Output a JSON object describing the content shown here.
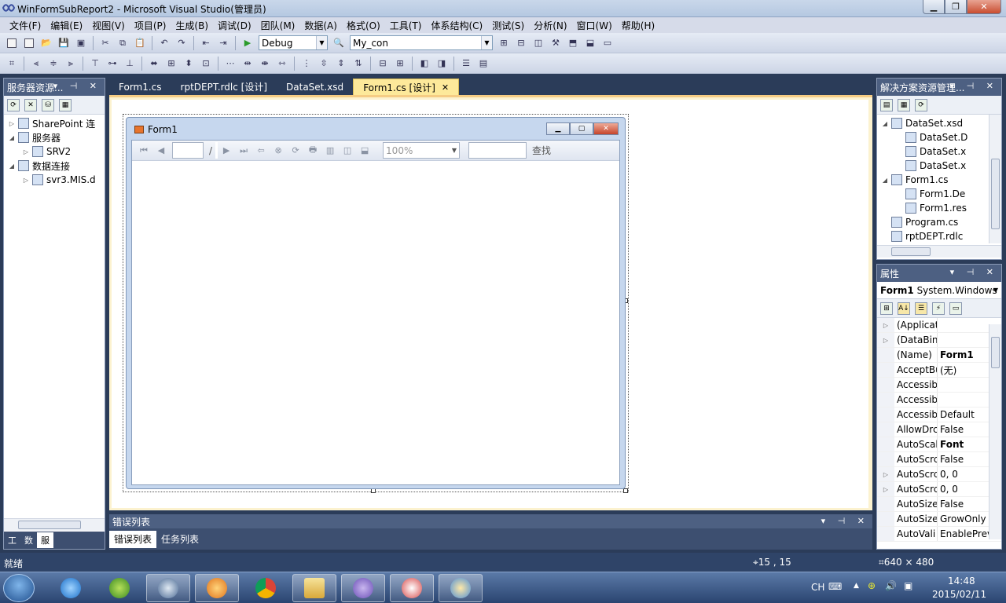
{
  "window": {
    "title": "WinFormSubReport2 - Microsoft Visual Studio(管理员)"
  },
  "menu": [
    "文件(F)",
    "编辑(E)",
    "视图(V)",
    "项目(P)",
    "生成(B)",
    "调试(D)",
    "团队(M)",
    "数据(A)",
    "格式(O)",
    "工具(T)",
    "体系结构(C)",
    "测试(S)",
    "分析(N)",
    "窗口(W)",
    "帮助(H)"
  ],
  "toolbar": {
    "config": "Debug",
    "connection": "My_con"
  },
  "server_explorer": {
    "title": "服务器资源...",
    "nodes": [
      {
        "label": "SharePoint 连",
        "indent": 0,
        "expander": "▷"
      },
      {
        "label": "服务器",
        "indent": 0,
        "expander": "◢"
      },
      {
        "label": "SRV2",
        "indent": 1,
        "expander": "▷"
      },
      {
        "label": "数据连接",
        "indent": 0,
        "expander": "◢"
      },
      {
        "label": "svr3.MIS.d",
        "indent": 1,
        "expander": "▷"
      }
    ],
    "bottom_tabs": [
      "工",
      "数",
      "服"
    ]
  },
  "doc_tabs": [
    {
      "label": "Form1.cs",
      "active": false
    },
    {
      "label": "rptDEPT.rdlc [设计]",
      "active": false
    },
    {
      "label": "DataSet.xsd",
      "active": false
    },
    {
      "label": "Form1.cs [设计]",
      "active": true
    }
  ],
  "form": {
    "title": "Form1",
    "viewer": {
      "page_sep": "/",
      "zoom": "100%",
      "find_label": "查找"
    }
  },
  "solution_explorer": {
    "title": "解决方案资源管理...",
    "nodes": [
      {
        "label": "DataSet.xsd",
        "indent": 0,
        "expander": "◢"
      },
      {
        "label": "DataSet.D",
        "indent": 1,
        "expander": ""
      },
      {
        "label": "DataSet.x",
        "indent": 1,
        "expander": ""
      },
      {
        "label": "DataSet.x",
        "indent": 1,
        "expander": ""
      },
      {
        "label": "Form1.cs",
        "indent": 0,
        "expander": "◢"
      },
      {
        "label": "Form1.De",
        "indent": 1,
        "expander": ""
      },
      {
        "label": "Form1.res",
        "indent": 1,
        "expander": ""
      },
      {
        "label": "Program.cs",
        "indent": 0,
        "expander": ""
      },
      {
        "label": "rptDEPT.rdlc",
        "indent": 0,
        "expander": ""
      }
    ]
  },
  "properties": {
    "title": "属性",
    "object_name": "Form1",
    "object_type": "System.Windows",
    "rows": [
      {
        "name": "(Applicat",
        "value": "",
        "expander": "▷",
        "bold": false
      },
      {
        "name": "(DataBin",
        "value": "",
        "expander": "▷",
        "bold": false
      },
      {
        "name": "(Name)",
        "value": "Form1",
        "expander": "",
        "bold": true
      },
      {
        "name": "AcceptBu",
        "value": "(无)",
        "expander": "",
        "bold": false
      },
      {
        "name": "Accessibl",
        "value": "",
        "expander": "",
        "bold": false
      },
      {
        "name": "Accessibl",
        "value": "",
        "expander": "",
        "bold": false
      },
      {
        "name": "Accessibl",
        "value": "Default",
        "expander": "",
        "bold": false
      },
      {
        "name": "AllowDrc",
        "value": "False",
        "expander": "",
        "bold": false
      },
      {
        "name": "AutoScal",
        "value": "Font",
        "expander": "",
        "bold": true
      },
      {
        "name": "AutoScrc",
        "value": "False",
        "expander": "",
        "bold": false
      },
      {
        "name": "AutoScrc",
        "value": "0, 0",
        "expander": "▷",
        "bold": false
      },
      {
        "name": "AutoScrc",
        "value": "0, 0",
        "expander": "▷",
        "bold": false
      },
      {
        "name": "AutoSize",
        "value": "False",
        "expander": "",
        "bold": false
      },
      {
        "name": "AutoSize",
        "value": "GrowOnly",
        "expander": "",
        "bold": false
      },
      {
        "name": "AutoVali",
        "value": "EnablePrev",
        "expander": "",
        "bold": false
      }
    ]
  },
  "error_list": {
    "title": "错误列表",
    "tabs": [
      "错误列表",
      "任务列表"
    ]
  },
  "status": {
    "text": "就绪",
    "position": "15 , 15",
    "size": "640 × 480"
  },
  "taskbar": {
    "lang": "CH",
    "time": "14:48",
    "date": "2015/02/11"
  }
}
